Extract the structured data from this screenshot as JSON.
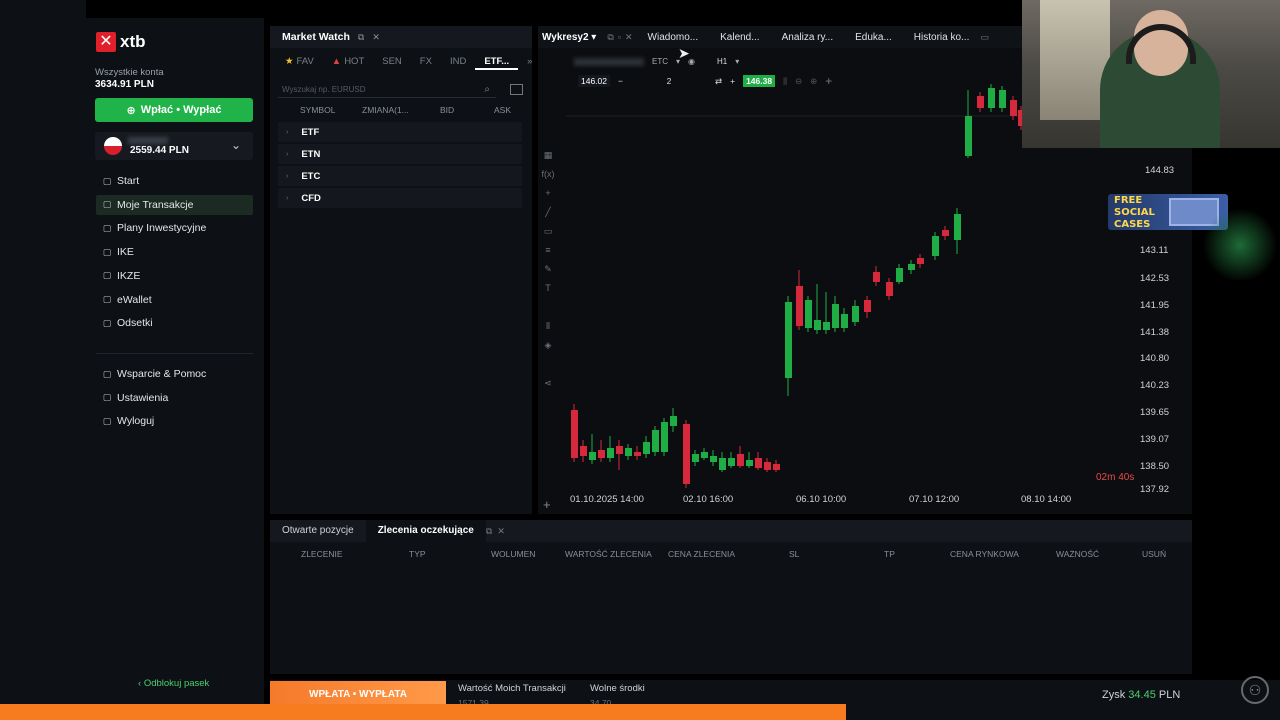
{
  "sidebar": {
    "logo_text": "xtb",
    "account_label": "Wszystkie konta",
    "account_value": "3634.91 PLN",
    "deposit_button": "Wpłać • Wypłać",
    "balance": "2559.44 PLN",
    "nav": [
      {
        "label": "Start",
        "icon": "home-icon"
      },
      {
        "label": "Moje Transakcje",
        "icon": "transactions-icon"
      },
      {
        "label": "Plany Inwestycyjne",
        "icon": "plans-icon"
      },
      {
        "label": "IKE",
        "icon": "ike-icon"
      },
      {
        "label": "IKZE",
        "icon": "ikze-icon"
      },
      {
        "label": "eWallet",
        "icon": "wallet-icon"
      },
      {
        "label": "Odsetki",
        "icon": "percent-icon"
      }
    ],
    "nav2": [
      {
        "label": "Wsparcie & Pomoc",
        "icon": "support-icon"
      },
      {
        "label": "Ustawienia",
        "icon": "gear-icon"
      },
      {
        "label": "Wyloguj",
        "icon": "logout-icon"
      }
    ],
    "unlock_label": "Odblokuj pasek"
  },
  "market_watch": {
    "title": "Market Watch",
    "tabs": [
      "FAV",
      "HOT",
      "SEN",
      "FX",
      "IND",
      "ETF..."
    ],
    "search_placeholder": "Wyszukaj np. EURUSD",
    "columns": [
      "SYMBOL",
      "ZMIANA(1...",
      "BID",
      "ASK"
    ],
    "rows": [
      "ETF",
      "ETN",
      "ETC",
      "CFD"
    ]
  },
  "charts": {
    "tabs": [
      "Wykresy2",
      "Wiadomo...",
      "Kalend...",
      "Analiza ry...",
      "Eduka...",
      "Historia ko..."
    ],
    "symbol_suffix": "ETC",
    "timeframe": "H1",
    "sell_price": "146.02",
    "volume": "2",
    "buy_price": "146.38",
    "y_labels": [
      "144.83",
      "143.11",
      "142.53",
      "141.95",
      "141.38",
      "140.80",
      "140.23",
      "139.65",
      "139.07",
      "138.50",
      "137.92"
    ],
    "x_labels": [
      "01.10.2025 14:00",
      "02.10 16:00",
      "06.10 10:00",
      "07.10 12:00",
      "08.10 14:00"
    ],
    "countdown": "02m 40s",
    "colors": {
      "up": "#1fae46",
      "down": "#d62a3c"
    }
  },
  "overlay": {
    "badge_line1": "FREE",
    "badge_line2": "SOCIAL",
    "badge_line3": "CASES"
  },
  "orders": {
    "tabs": [
      "Otwarte pozycje",
      "Zlecenia oczekujące"
    ],
    "columns": [
      "ZLECENIE",
      "TYP",
      "WOLUMEN",
      "WARTOŚĆ ZLECENIA",
      "CENA ZLECENIA",
      "SL",
      "TP",
      "CENA RYNKOWA",
      "WAŻNOŚĆ",
      "USUŃ"
    ]
  },
  "footer": {
    "deposit_button": "WPŁATA • WYPŁATA",
    "value_label": "Wartość Moich Transakcji",
    "value": "1571.39",
    "free_label": "Wolne środki",
    "free_value": "34.70",
    "profit_label": "Zysk",
    "profit_value": "34.45",
    "profit_currency": "PLN"
  }
}
